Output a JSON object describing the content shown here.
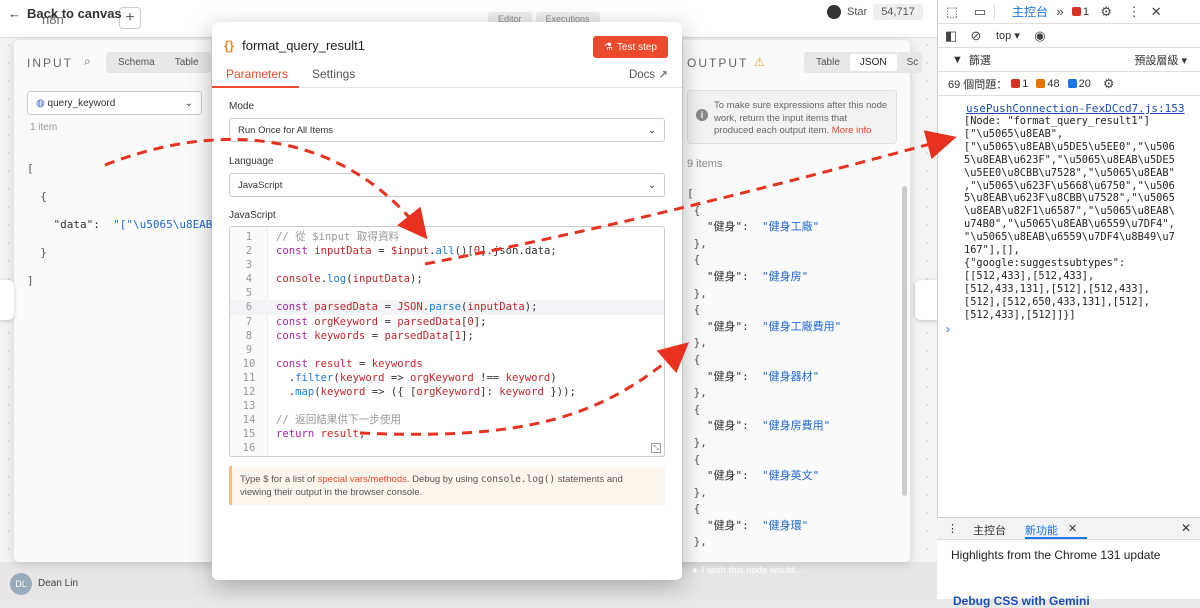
{
  "topbar": {
    "back_label": "Back to canvas",
    "workflow_name": "n8n",
    "tabs": [
      "Editor",
      "Executions"
    ],
    "star_label": "Star",
    "star_count": "54,717"
  },
  "input_panel": {
    "header": "INPUT",
    "tabs": [
      "Schema",
      "Table"
    ],
    "selected_node": "query_keyword",
    "item_count": "1 item",
    "json_lines": [
      "[",
      "  {",
      "    \"data\":  \"[\\\"\\u5065\\u8EAB\\\"",
      "  }",
      "]"
    ]
  },
  "node": {
    "title": "format_query_result1",
    "test_button": "Test step",
    "tabs": {
      "parameters": "Parameters",
      "settings": "Settings",
      "docs": "Docs"
    },
    "mode_label": "Mode",
    "mode_value": "Run Once for All Items",
    "language_label": "Language",
    "language_value": "JavaScript",
    "code_label": "JavaScript",
    "hint_pre": "Type $ for a list of ",
    "hint_link": "special vars/methods",
    "hint_mid": ". Debug by using ",
    "hint_code": "console.log()",
    "hint_post": " statements and viewing their output in the browser console."
  },
  "output_panel": {
    "header": "OUTPUT",
    "tabs": [
      "Table",
      "JSON",
      "Sc"
    ],
    "notice": "To make sure expressions after this node work, return the input items that produced each output item.",
    "notice_link": "More info",
    "item_count": "9 items",
    "items": [
      {
        "key": "\"健身\":",
        "value": "\"健身工廠\""
      },
      {
        "key": "\"健身\":",
        "value": "\"健身房\""
      },
      {
        "key": "\"健身\":",
        "value": "\"健身工廠費用\""
      },
      {
        "key": "\"健身\":",
        "value": "\"健身器材\""
      },
      {
        "key": "\"健身\":",
        "value": "\"健身房費用\""
      },
      {
        "key": "\"健身\":",
        "value": "\"健身英文\""
      },
      {
        "key": "\"健身\":",
        "value": "\"健身環\""
      }
    ],
    "bottom_note": "I wish this node would..."
  },
  "bottom": {
    "user_name": "Dean Lin",
    "user_initials": "DL"
  },
  "devtools": {
    "console_tab": "主控台",
    "error_count": "1",
    "filter_label": "篩選",
    "context": "top",
    "levels": "預設層級",
    "issues_label": "69 個問題：",
    "issues_err": "1",
    "issues_warn": "48",
    "issues_info": "20",
    "source_link": "usePushConnection-FexDCcd7.js:153",
    "log_lines": [
      "[Node: \"format_query_result1\"]",
      "[\"\\u5065\\u8EAB\",",
      "[\"\\u5065\\u8EAB\\u5DE5\\u5EE0\",\"\\u506",
      "5\\u8EAB\\u623F\",\"\\u5065\\u8EAB\\u5DE5",
      "\\u5EE0\\u8CBB\\u7528\",\"\\u5065\\u8EAB\"",
      ",\"\\u5065\\u623F\\u5668\\u6750\",\"\\u506",
      "5\\u8EAB\\u623F\\u8CBB\\u7528\",\"\\u5065",
      "\\u8EAB\\u82F1\\u6587\",\"\\u5065\\u8EAB\\",
      "u74B0\",\"\\u5065\\u8EAB\\u6559\\u7DF4\",",
      "\"\\u5065\\u8EAB\\u6559\\u7DF4\\u8B49\\u7",
      "167\"],[],",
      "{\"google:suggestsubtypes\":",
      "[[512,433],[512,433],",
      "[512,433,131],[512],[512,433],",
      "[512],[512,650,433,131],[512],",
      "[512,433],[512]]}]"
    ],
    "drawer_tabs": [
      "主控台",
      "新功能"
    ],
    "drawer_heading": "Highlights from the Chrome 131 update",
    "drawer_sub": "Debug CSS with Gemini"
  },
  "colors": {
    "accent": "#ea4b2c",
    "arrow": "#e8321f",
    "link": "#1a73e8"
  }
}
